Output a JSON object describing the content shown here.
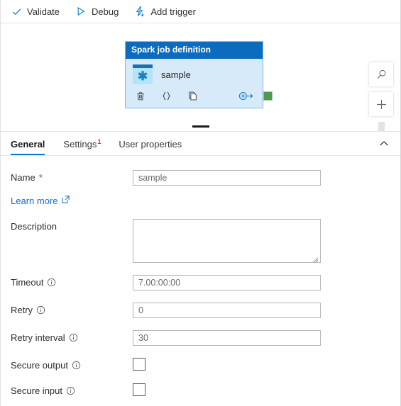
{
  "toolbar": {
    "items": [
      {
        "label": "Validate",
        "icon": "check-icon"
      },
      {
        "label": "Debug",
        "icon": "play-icon"
      },
      {
        "label": "Add trigger",
        "icon": "lightning-bolt-plus-icon"
      }
    ]
  },
  "canvas": {
    "node": {
      "header": "Spark job definition",
      "name": "sample",
      "icon": "spark-job-definition-icon",
      "actions": [
        {
          "name": "delete-icon",
          "glyph": "Ὕ1"
        },
        {
          "name": "code-braces-icon",
          "glyph": "{}"
        },
        {
          "name": "copy-icon",
          "glyph": "copy"
        },
        {
          "name": "add-output-icon",
          "glyph": "add-arrow"
        }
      ]
    },
    "controls": [
      {
        "name": "search-icon",
        "label": "Search"
      },
      {
        "name": "zoom-in-icon",
        "label": "Zoom in"
      }
    ],
    "annotation": {
      "shape": "circle",
      "color": "#ef2727"
    },
    "connector_color": "#4e9a51"
  },
  "tabs": [
    {
      "label": "General",
      "active": true,
      "badge": ""
    },
    {
      "label": "Settings",
      "active": false,
      "badge": "1"
    },
    {
      "label": "User properties",
      "active": false,
      "badge": ""
    }
  ],
  "form": {
    "name": {
      "label": "Name",
      "required": "*",
      "value": "sample"
    },
    "learn_more": {
      "label": "Learn more",
      "icon": "external-link-icon"
    },
    "description": {
      "label": "Description",
      "value": ""
    },
    "timeout": {
      "label": "Timeout",
      "value": "7.00:00:00"
    },
    "retry": {
      "label": "Retry",
      "value": "0"
    },
    "retry_interval": {
      "label": "Retry interval",
      "value": "30"
    },
    "secure_output": {
      "label": "Secure output",
      "checked": false
    },
    "secure_input": {
      "label": "Secure input",
      "checked": false
    }
  },
  "colors": {
    "accent": "#0078d4",
    "node_header": "#0b6cbf",
    "node_body": "#d7eafa",
    "badge_red": "#d13438",
    "annotation_red": "#ef2727",
    "connector_green": "#4e9a51"
  }
}
